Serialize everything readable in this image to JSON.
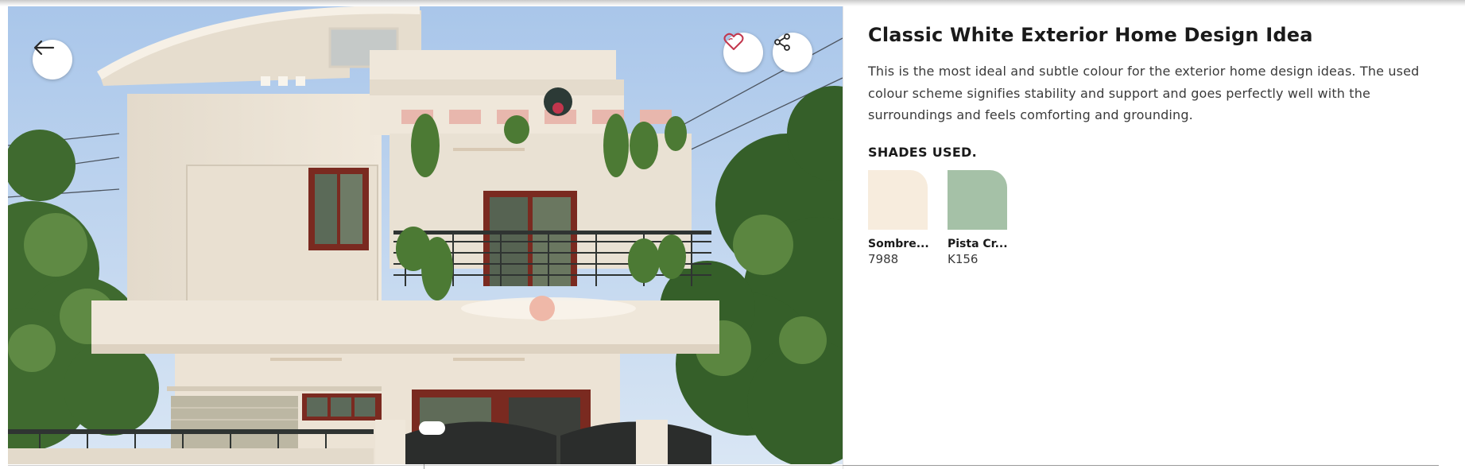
{
  "design": {
    "title": "Classic White Exterior Home Design Idea",
    "description": "This is the most ideal and subtle colour for the exterior home design ideas. The used colour scheme signifies stability and support and goes perfectly well with the surroundings and feels comforting and grounding.",
    "shades_heading": "SHADES USED.",
    "shades": [
      {
        "name": "Sombre...",
        "code": "7988",
        "color": "#f7ecdd"
      },
      {
        "name": "Pista Cr...",
        "code": "K156",
        "color": "#a5c1a7"
      }
    ]
  },
  "gallery": {
    "image_alt": "house-exterior-image",
    "slide_count": 1,
    "active_slide": 1
  },
  "icons": {
    "back": "arrow-left-icon",
    "favorite": "heart-icon",
    "share": "share-icon"
  },
  "colors": {
    "accent": "#c2364d",
    "wall": "#efe7da",
    "trim": "#7a2a20"
  }
}
